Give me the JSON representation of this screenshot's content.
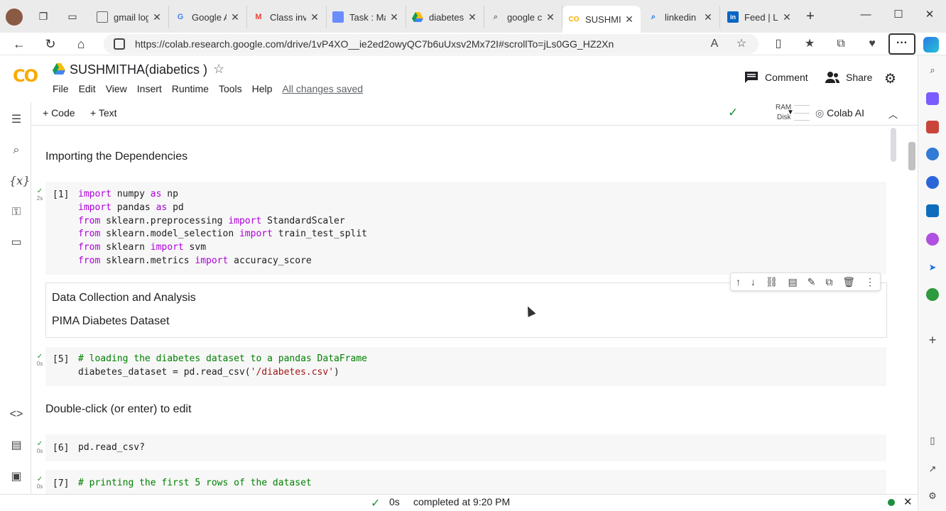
{
  "browser": {
    "tabs": [
      {
        "title": "gmail log",
        "icon": "doc-icon"
      },
      {
        "title": "Google A",
        "icon": "google-icon"
      },
      {
        "title": "Class inv",
        "icon": "gmail-icon"
      },
      {
        "title": "Task : Ma",
        "icon": "task-icon"
      },
      {
        "title": "diabetes",
        "icon": "drive-icon"
      },
      {
        "title": "google c",
        "icon": "search-icon"
      },
      {
        "title": "SUSHMI",
        "icon": "colab-icon",
        "active": true
      },
      {
        "title": "linkedin",
        "icon": "search-icon"
      },
      {
        "title": "Feed | Li",
        "icon": "linkedin-icon"
      }
    ],
    "url": "https://colab.research.google.com/drive/1vP4XO__ie2ed2owyQC7b6uUxsv2Mx72I#scrollTo=jLs0GG_HZ2Xn"
  },
  "colab": {
    "logo": "CO",
    "title": "SUSHMITHA(diabetics )",
    "menus": [
      "File",
      "Edit",
      "View",
      "Insert",
      "Runtime",
      "Tools",
      "Help"
    ],
    "saved_status": "All changes saved",
    "comment_label": "Comment",
    "share_label": "Share",
    "add_code": "+ Code",
    "add_text": "+ Text",
    "ram_label": "RAM",
    "disk_label": "Disk",
    "colab_ai": "Colab AI"
  },
  "cells": {
    "heading1": "Importing the Dependencies",
    "c1": {
      "prompt": "[1]",
      "time": "2s"
    },
    "md2_line1": "Data Collection and Analysis",
    "md2_line2": "PIMA Diabetes Dataset",
    "c5": {
      "prompt": "[5]",
      "time": "0s"
    },
    "heading3": "Double-click (or enter) to edit",
    "c6": {
      "prompt": "[6]",
      "time": "0s",
      "code": "pd.read_csv?"
    },
    "c7": {
      "prompt": "[7]",
      "time": "0s",
      "code": "# printing the first 5 rows of the dataset"
    }
  },
  "status": {
    "duration": "0s",
    "completed": "completed at 9:20 PM"
  },
  "colors": {
    "accent_orange": "#f9ab00",
    "success_green": "#1e8e3e",
    "keyword_purple": "#af00db",
    "comment_green": "#008000"
  }
}
